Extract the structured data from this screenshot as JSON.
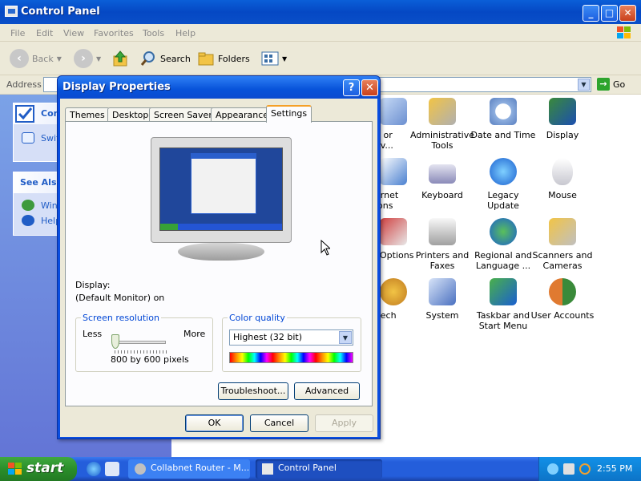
{
  "window": {
    "title": "Control Panel",
    "menu": [
      "File",
      "Edit",
      "View",
      "Favorites",
      "Tools",
      "Help"
    ],
    "toolbar": {
      "back": "Back",
      "search": "Search",
      "folders": "Folders"
    },
    "address_label": "Address",
    "go_label": "Go"
  },
  "taskpane": {
    "box1_title": "Con",
    "box1_link": "Swit",
    "box2_title": "See Als",
    "box2_links": [
      "Win",
      "Help"
    ]
  },
  "icons": [
    {
      "label": "d or\nov...",
      "name": "add-remove-icon"
    },
    {
      "label": "Administrative\nTools",
      "name": "administrative-tools-icon"
    },
    {
      "label": "Date and Time",
      "name": "date-time-icon"
    },
    {
      "label": "Display",
      "name": "display-icon"
    },
    {
      "label": "ernet\nions",
      "name": "internet-options-icon"
    },
    {
      "label": "Keyboard",
      "name": "keyboard-icon"
    },
    {
      "label": "Legacy\nUpdate",
      "name": "legacy-update-icon"
    },
    {
      "label": "Mouse",
      "name": "mouse-icon"
    },
    {
      "label": "Options",
      "name": "options-icon"
    },
    {
      "label": "Printers and\nFaxes",
      "name": "printers-faxes-icon"
    },
    {
      "label": "Regional and\nLanguage ...",
      "name": "regional-language-icon"
    },
    {
      "label": "Scanners and\nCameras",
      "name": "scanners-cameras-icon"
    },
    {
      "label": "eech",
      "name": "speech-icon"
    },
    {
      "label": "System",
      "name": "system-icon"
    },
    {
      "label": "Taskbar and\nStart Menu",
      "name": "taskbar-start-menu-icon"
    },
    {
      "label": "User Accounts",
      "name": "user-accounts-icon"
    }
  ],
  "dialog": {
    "title": "Display Properties",
    "help": "?",
    "close": "✕",
    "tabs": [
      "Themes",
      "Desktop",
      "Screen Saver",
      "Appearance",
      "Settings"
    ],
    "active_tab": "Settings",
    "display_label": "Display:",
    "display_value": "(Default Monitor) on",
    "resolution": {
      "title": "Screen resolution",
      "less": "Less",
      "more": "More",
      "value": "800 by 600 pixels",
      "slider_level": 0
    },
    "color": {
      "title": "Color quality",
      "selected": "Highest (32 bit)"
    },
    "buttons": {
      "troubleshoot": "Troubleshoot...",
      "advanced": "Advanced",
      "ok": "OK",
      "cancel": "Cancel",
      "apply": "Apply"
    }
  },
  "taskbar": {
    "start": "start",
    "tasks": [
      "Collabnet Router - M...",
      "Control Panel"
    ],
    "clock": "2:55 PM"
  },
  "colors": {
    "title_blue": "#0a4fd0",
    "taskbar_blue": "#245edb",
    "start_green": "#2a8e2a",
    "accent_orange": "#f5a028"
  }
}
